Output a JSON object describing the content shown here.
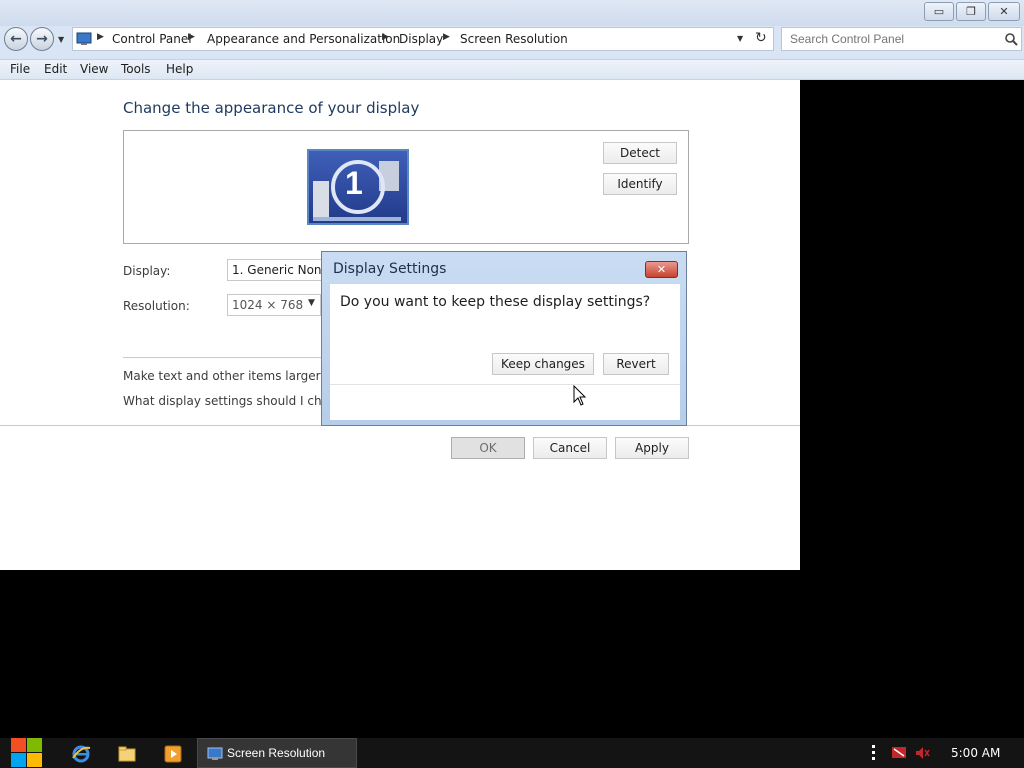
{
  "window": {
    "title_buttons": {
      "minimize": "▭",
      "maximize": "❐",
      "close": "✕"
    },
    "address": {
      "crumbs": [
        "Control Panel",
        "Appearance and Personalization",
        "Display",
        "Screen Resolution"
      ]
    },
    "search": {
      "placeholder": "Search Control Panel"
    },
    "menu": [
      "File",
      "Edit",
      "View",
      "Tools",
      "Help"
    ]
  },
  "page": {
    "title": "Change the appearance of your display",
    "monitor_number": "1",
    "detect_label": "Detect",
    "identify_label": "Identify",
    "display_label": "Display:",
    "display_value": "1. Generic Non-P",
    "resolution_label": "Resolution:",
    "resolution_value": "1024 × 768",
    "link1": "Make text and other items larger or sm",
    "link2": "What display settings should I choose",
    "ok_label": "OK",
    "cancel_label": "Cancel",
    "apply_label": "Apply"
  },
  "dialog": {
    "title": "Display Settings",
    "question": "Do you want to keep these display settings?",
    "keep_label": "Keep changes",
    "revert_label": "Revert"
  },
  "taskbar": {
    "active_task": "Screen Resolution",
    "clock": "5:00 AM"
  },
  "colors": {
    "accent_blue": "#2b4ea0",
    "taskbar": "#141414",
    "dialog_frame": "#b6cde9"
  }
}
